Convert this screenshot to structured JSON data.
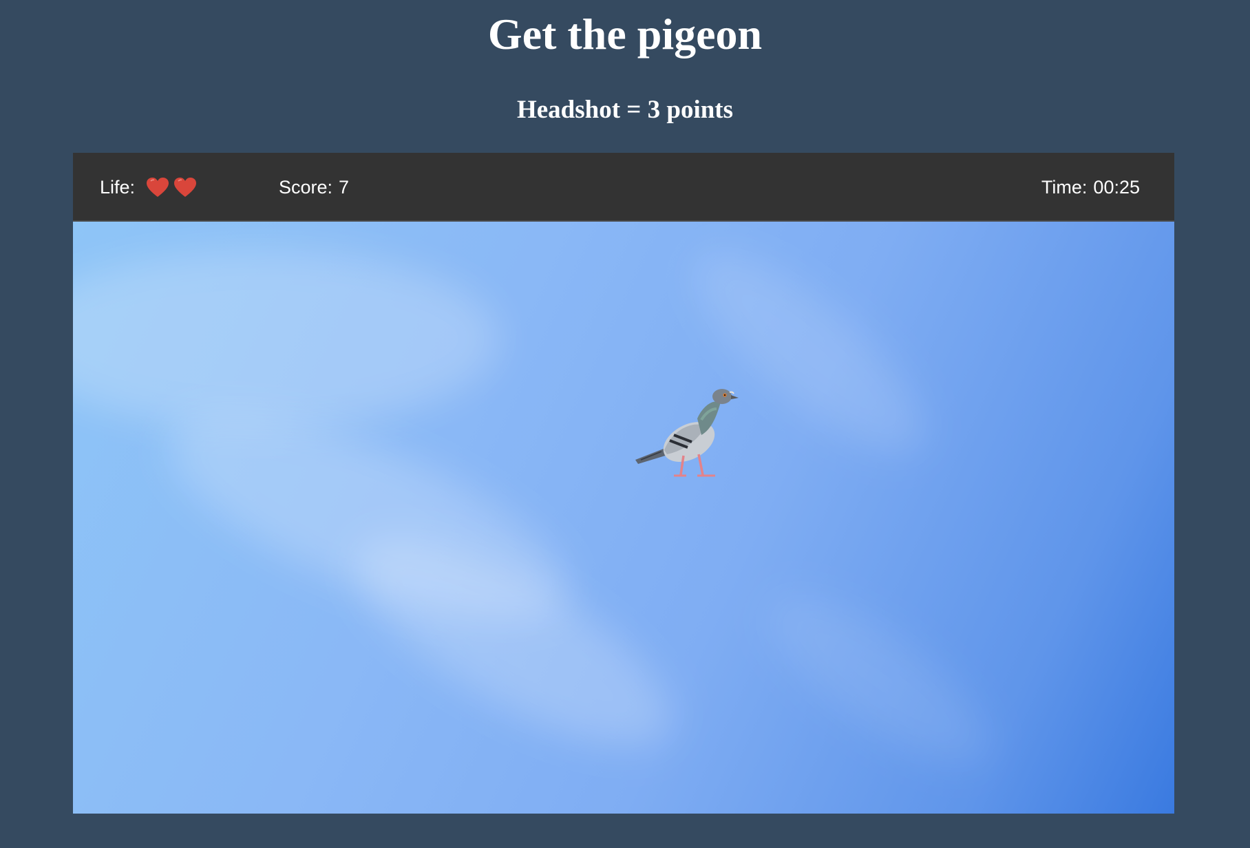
{
  "page": {
    "title": "Get the pigeon",
    "subtitle": "Headshot = 3 points"
  },
  "hud": {
    "life_label": "Life:",
    "lives": 2,
    "score_label": "Score:",
    "score_value": "7",
    "time_label": "Time:",
    "time_value": "00:25"
  },
  "game": {
    "target_icon": "pigeon-icon",
    "life_icon": "heart-icon"
  },
  "colors": {
    "page_background": "#354a60",
    "hud_background": "#333333",
    "heart": "#d9463b",
    "sky_light": "#8ec5f7",
    "sky_dark": "#3a7ae0"
  }
}
